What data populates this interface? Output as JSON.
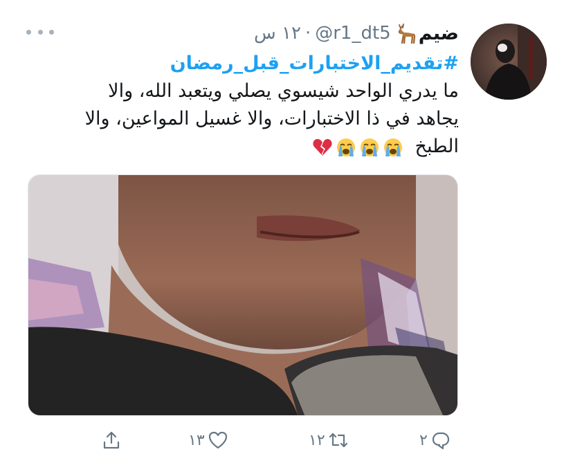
{
  "tweet": {
    "display_name": "ضيم",
    "handle": "@r1_dt5",
    "separator": "·",
    "time": "١٢ س",
    "hashtag": "#تقديم_الاختبارات_قبل_رمضان",
    "text_lines": [
      "ما يدري الواحد شيسوي يصلي ويتعبد الله، والا",
      "يجاهد في ذا الاختبارات، والا غسيل المواعين، والا",
      "الطبخ"
    ],
    "emojis": [
      "loudly-crying-face-emoji",
      "loudly-crying-face-emoji",
      "loudly-crying-face-emoji",
      "broken-heart-emoji"
    ],
    "name_icon": "deer-icon",
    "media_alt_icon": "photo-closeup-face"
  },
  "actions": {
    "reply_count": "٢",
    "retweet_count": "١٢",
    "like_count": "١٣",
    "share_icon": "share-icon"
  },
  "colors": {
    "link": "#1da1f2",
    "text": "#14171a",
    "secondary": "#657786",
    "icon": "#657786"
  }
}
